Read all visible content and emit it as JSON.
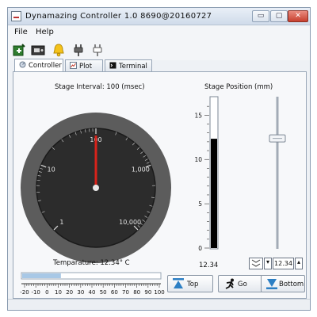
{
  "window": {
    "title": "Dynamazing Controller 1.0 8690@20160727",
    "minimize_label": "▭",
    "maximize_label": "▢",
    "close_label": "✕"
  },
  "menu": {
    "file": "File",
    "help": "Help"
  },
  "toolbar": {
    "icons": [
      "power-connect-icon",
      "device-icon",
      "alarm-bell-icon",
      "plug-icon",
      "plug-outline-icon"
    ]
  },
  "tabs": [
    {
      "label": "Controller",
      "icon": "controller-icon",
      "active": true
    },
    {
      "label": "Plot",
      "icon": "plot-icon",
      "active": false
    },
    {
      "label": "Terminal",
      "icon": "terminal-icon",
      "active": false
    }
  ],
  "controller": {
    "stage_interval_label": "Stage Interval: 100 (msec)",
    "stage_interval_value": 100,
    "gauge_ticks": [
      "1",
      "10",
      "100",
      "1,000",
      "10,000"
    ],
    "temperature_label": "Temparature: 12.34° C",
    "temperature_value": 12.34,
    "temp_scale_ticks": [
      "-20",
      "-10",
      "0",
      "10",
      "20",
      "30",
      "40",
      "50",
      "60",
      "70",
      "80",
      "90",
      "100"
    ],
    "stage_position_label": "Stage Position (mm)",
    "position_ticks": [
      "15",
      "10",
      "5",
      "0"
    ],
    "position_value": 12.34,
    "position_readout": "12.34",
    "spin_value": "12.34",
    "buttons": {
      "top": "Top",
      "go": "Go",
      "bottom": "Bottom"
    }
  },
  "colors": {
    "gauge_outer": "#5c5c5c",
    "gauge_face": "#2c2c2c",
    "needle": "#d8231b",
    "bar_fill": "#000000",
    "temp_fill": "#a8c8e6"
  }
}
